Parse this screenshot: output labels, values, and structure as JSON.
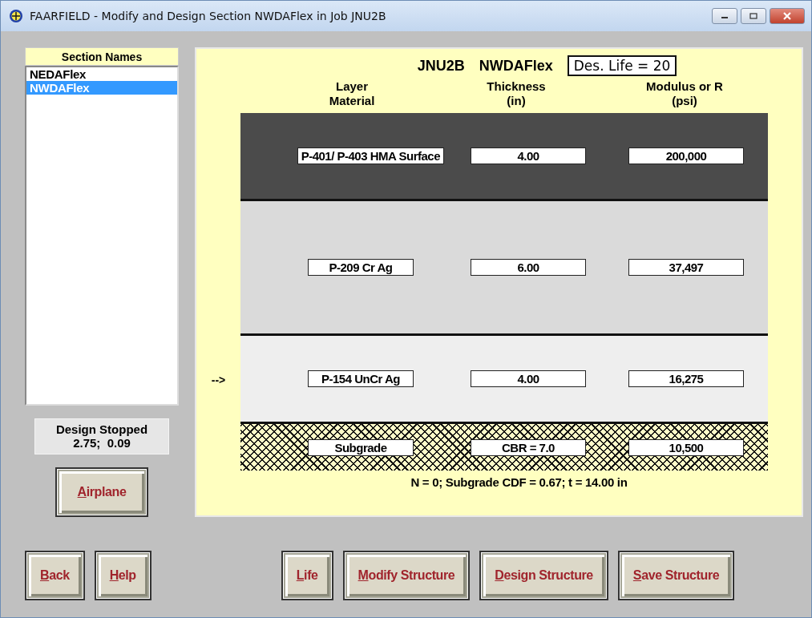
{
  "window": {
    "title": "FAARFIELD - Modify and Design Section NWDAFlex in Job JNU2B"
  },
  "sections": {
    "heading": "Section Names",
    "items": [
      {
        "label": "NEDAFlex",
        "selected": false
      },
      {
        "label": "NWDAFlex",
        "selected": true
      }
    ]
  },
  "status": {
    "title": "Design Stopped",
    "values": "2.75;  0.09"
  },
  "airplane_button": {
    "key": "A",
    "rest": "irplane"
  },
  "structure": {
    "job": "JNU2B",
    "section": "NWDAFlex",
    "life": "Des. Life = 20",
    "columns": [
      {
        "line1": "Layer",
        "line2": "Material"
      },
      {
        "line1": "Thickness",
        "line2": "(in)"
      },
      {
        "line1": "Modulus or R",
        "line2": "(psi)"
      }
    ],
    "layers": [
      {
        "kind": "dark",
        "material": "P-401/ P-403 HMA Surface",
        "thickness": "4.00",
        "modulus": "200,000"
      },
      {
        "kind": "base",
        "material": "P-209 Cr Ag",
        "thickness": "6.00",
        "modulus": "37,497"
      },
      {
        "kind": "subbase",
        "material": "P-154 UnCr Ag",
        "thickness": "4.00",
        "modulus": "16,275",
        "marker": "-->"
      },
      {
        "kind": "subgrade",
        "material": "Subgrade",
        "thickness": "CBR = 7.0",
        "modulus": "10,500"
      }
    ],
    "summary": "N = 0;  Subgrade CDF = 0.67;  t = 14.00 in"
  },
  "nav_buttons": [
    {
      "key": "B",
      "rest": "ack"
    },
    {
      "key": "H",
      "rest": "elp"
    }
  ],
  "structure_buttons": [
    {
      "key": "L",
      "rest": "ife"
    },
    {
      "key": "M",
      "rest": "odify Structure"
    },
    {
      "key": "D",
      "rest": "esign Structure"
    },
    {
      "key": "S",
      "rest": "ave Structure"
    }
  ]
}
